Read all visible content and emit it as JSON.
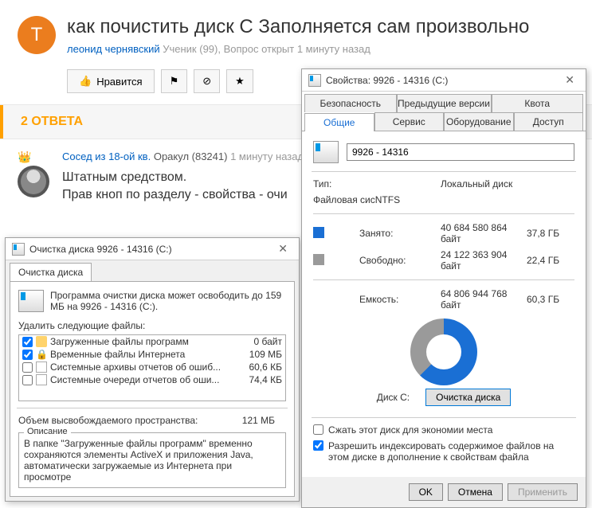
{
  "question": {
    "title": "как почистить диск С Заполняется сам произвольно",
    "author": "леонид чернявский",
    "rank": "Ученик (99)",
    "status": "Вопрос открыт 1 минуту назад"
  },
  "actions": {
    "like": "Нравится"
  },
  "answers": {
    "heading": "2 ОТВЕТА",
    "a1": {
      "author": "Сосед из 18-ой кв.",
      "rank": "Оракул (83241)",
      "time": "1 минуту назад",
      "line1": "Штатным средством.",
      "line2": "Прав кноп по разделу - свойства - очи"
    }
  },
  "cleanup": {
    "title": "Очистка диска 9926 - 14316 (C:)",
    "tab": "Очистка диска",
    "intro": "Программа очистки диска может освободить до 159 МБ на 9926 - 14316 (C:).",
    "list_label": "Удалить следующие файлы:",
    "files": {
      "f0": {
        "name": "Загруженные файлы программ",
        "size": "0 байт",
        "checked": true
      },
      "f1": {
        "name": "Временные файлы Интернета",
        "size": "109 МБ",
        "checked": true
      },
      "f2": {
        "name": "Системные архивы отчетов об ошиб...",
        "size": "60,6 КБ",
        "checked": false
      },
      "f3": {
        "name": "Системные очереди отчетов об оши...",
        "size": "74,4 КБ",
        "checked": false
      }
    },
    "sum_label": "Объем высвобождаемого пространства:",
    "sum_value": "121 МБ",
    "desc_label": "Описание",
    "desc_text": "В папке \"Загруженные файлы программ\" временно сохраняются элементы ActiveX и приложения Java, автоматически загружаемые из Интернета при просмотре"
  },
  "props": {
    "title": "Свойства: 9926 - 14316 (C:)",
    "tabs": {
      "security": "Безопасность",
      "prev": "Предыдущие версии",
      "quota": "Квота",
      "general": "Общие",
      "service": "Сервис",
      "hardware": "Оборудование",
      "access": "Доступ"
    },
    "name_value": "9926 - 14316",
    "type_label": "Тип:",
    "type_value": "Локальный диск",
    "fs_label": "Файловая сис",
    "fs_value": "NTFS",
    "used_label": "Занято:",
    "used_bytes": "40 684 580 864 байт",
    "used_gb": "37,8 ГБ",
    "free_label": "Свободно:",
    "free_bytes": "24 122 363 904 байт",
    "free_gb": "22,4 ГБ",
    "cap_label": "Емкость:",
    "cap_bytes": "64 806 944 768 байт",
    "cap_gb": "60,3 ГБ",
    "disk_label": "Диск C:",
    "cleanup_btn": "Очистка диска",
    "compress": "Сжать этот диск для экономии места",
    "index": "Разрешить индексировать содержимое файлов на этом диске в дополнение к свойствам файла",
    "ok": "OK",
    "cancel": "Отмена",
    "apply": "Применить"
  }
}
